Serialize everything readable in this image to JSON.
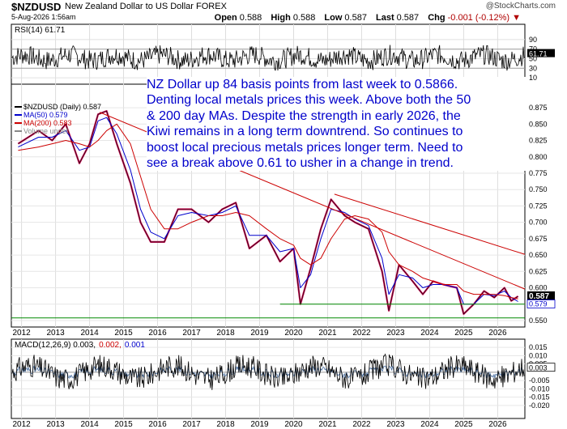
{
  "header": {
    "symbol": "$NZDUSD",
    "name": "New Zealand Dollar to US Dollar",
    "exchange": "FOREX",
    "datetime": "5-Aug-2026 1:56am",
    "watermark": "@StockCharts.com",
    "open_label": "Open",
    "open": "0.588",
    "high_label": "High",
    "high": "0.588",
    "low_label": "Low",
    "low": "0.587",
    "last_label": "Last",
    "last": "0.587",
    "chg_label": "Chg",
    "chg": "-0.001 (-0.12%)",
    "chg_marker": "▼"
  },
  "annotation": [
    "NZ Dollar up 84 basis points from last week to 0.5866.",
    "Denting local metals prices this week. Above both the 50",
    "& 200 day MAs. Despite the strength in early 2026, the",
    "Kiwi remains in a long term downtrend. So continues to",
    "boost local precious metals prices longer term. Need to",
    "see a break above 0.61 to usher in a change in trend."
  ],
  "chart_data": [
    {
      "type": "line",
      "panel": "RSI",
      "legend": "RSI(14) 61.71",
      "y_ticks": [
        90,
        70,
        50,
        30,
        10
      ],
      "last_label": "61.71",
      "ylim": [
        0,
        100
      ]
    },
    {
      "type": "line",
      "panel": "price",
      "legend": [
        {
          "name": "$NZDUSD (Daily) 0.587",
          "color": "#000000"
        },
        {
          "name": "MA(50) 0.579",
          "color": "#0000cc"
        },
        {
          "name": "MA(200) 0.583",
          "color": "#cc0000"
        },
        {
          "name": "Volume undef",
          "color": "#888888"
        }
      ],
      "y_ticks": [
        0.875,
        0.85,
        0.825,
        0.8,
        0.775,
        0.75,
        0.725,
        0.7,
        0.675,
        0.65,
        0.625,
        0.6,
        0.575,
        0.55
      ],
      "last_labels": {
        "price": "0.587",
        "ma50": "0.579"
      },
      "ylim": [
        0.545,
        0.885
      ],
      "x": [
        2011.9,
        2012.5,
        2012.9,
        2013.3,
        2013.7,
        2014.0,
        2014.25,
        2014.5,
        2014.8,
        2015.2,
        2015.5,
        2015.8,
        2016.2,
        2016.6,
        2017.0,
        2017.5,
        2017.9,
        2018.3,
        2018.7,
        2019.2,
        2019.6,
        2020.0,
        2020.2,
        2020.5,
        2020.8,
        2021.1,
        2021.5,
        2021.8,
        2022.2,
        2022.6,
        2022.8,
        2023.1,
        2023.5,
        2023.8,
        2024.1,
        2024.4,
        2024.8,
        2025.0,
        2025.3,
        2025.6,
        2025.9,
        2026.2,
        2026.4,
        2026.6
      ],
      "series": [
        {
          "name": "$NZDUSD",
          "values": [
            0.82,
            0.84,
            0.825,
            0.85,
            0.79,
            0.82,
            0.865,
            0.87,
            0.82,
            0.76,
            0.7,
            0.67,
            0.67,
            0.72,
            0.72,
            0.7,
            0.72,
            0.73,
            0.66,
            0.68,
            0.64,
            0.66,
            0.575,
            0.63,
            0.69,
            0.735,
            0.71,
            0.7,
            0.69,
            0.625,
            0.565,
            0.635,
            0.61,
            0.59,
            0.61,
            0.605,
            0.6,
            0.56,
            0.575,
            0.595,
            0.585,
            0.6,
            0.58,
            0.587
          ]
        },
        {
          "name": "MA(50)",
          "values": [
            0.815,
            0.83,
            0.83,
            0.84,
            0.81,
            0.815,
            0.855,
            0.86,
            0.835,
            0.78,
            0.72,
            0.685,
            0.675,
            0.71,
            0.715,
            0.71,
            0.715,
            0.725,
            0.68,
            0.68,
            0.655,
            0.66,
            0.6,
            0.62,
            0.675,
            0.72,
            0.715,
            0.705,
            0.695,
            0.645,
            0.59,
            0.62,
            0.615,
            0.6,
            0.605,
            0.605,
            0.6,
            0.575,
            0.575,
            0.59,
            0.588,
            0.595,
            0.585,
            0.579
          ]
        },
        {
          "name": "MA(200)",
          "values": [
            0.81,
            0.815,
            0.82,
            0.825,
            0.82,
            0.815,
            0.825,
            0.84,
            0.85,
            0.82,
            0.77,
            0.72,
            0.69,
            0.69,
            0.7,
            0.71,
            0.71,
            0.715,
            0.71,
            0.69,
            0.675,
            0.665,
            0.645,
            0.635,
            0.645,
            0.675,
            0.705,
            0.71,
            0.705,
            0.685,
            0.655,
            0.635,
            0.625,
            0.615,
            0.61,
            0.605,
            0.605,
            0.595,
            0.59,
            0.59,
            0.59,
            0.588,
            0.585,
            0.583
          ]
        }
      ],
      "trendlines": [
        {
          "x": [
            2014.3,
            2026.8
          ],
          "y": [
            0.868,
            0.598
          ],
          "color": "#cc0000"
        },
        {
          "x": [
            2021.2,
            2026.8
          ],
          "y": [
            0.743,
            0.651
          ],
          "color": "#cc0000"
        },
        {
          "x": [
            2019.6,
            2026.8
          ],
          "y": [
            0.575,
            0.575
          ],
          "color": "#008800"
        },
        {
          "x": [
            2011.7,
            2026.8
          ],
          "y": [
            0.554,
            0.554
          ],
          "color": "#008800"
        }
      ]
    },
    {
      "type": "line",
      "panel": "MACD",
      "legend": [
        "MACD(12,26,9) 0.003,",
        "0.002,",
        "0.001"
      ],
      "legend_colors": [
        "#000000",
        "#cc0000",
        "#0000cc"
      ],
      "y_ticks": [
        "0.015",
        "0.010",
        "0.005",
        "-0.005",
        "-0.010",
        "-0.015",
        "-0.020"
      ],
      "last_label": "0.003",
      "ylim": [
        -0.022,
        0.017
      ]
    }
  ],
  "x_axis": {
    "labels": [
      "2012",
      "2013",
      "2014",
      "2015",
      "2016",
      "2017",
      "2018",
      "2019",
      "2020",
      "2021",
      "2022",
      "2023",
      "2024",
      "2025",
      "2026"
    ],
    "range": [
      2011.7,
      2026.8
    ]
  }
}
